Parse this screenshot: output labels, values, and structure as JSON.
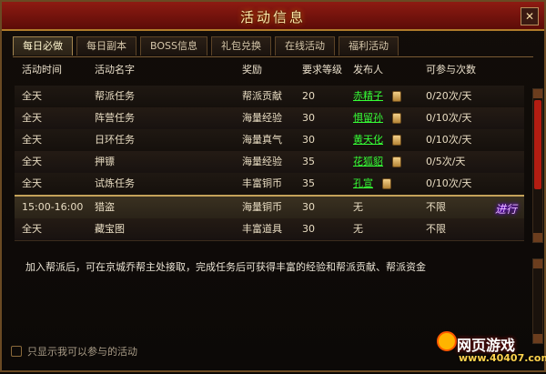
{
  "window": {
    "title": "活动信息",
    "close_glyph": "✕"
  },
  "tabs": [
    {
      "label": "每日必做",
      "active": true
    },
    {
      "label": "每日副本",
      "active": false
    },
    {
      "label": "BOSS信息",
      "active": false
    },
    {
      "label": "礼包兑换",
      "active": false
    },
    {
      "label": "在线活动",
      "active": false
    },
    {
      "label": "福利活动",
      "active": false
    }
  ],
  "table": {
    "headers": {
      "time": "活动时间",
      "name": "活动名字",
      "reward": "奖励",
      "level": "要求等级",
      "issuer": "发布人",
      "times": "可参与次数"
    },
    "rows": [
      {
        "time": "全天",
        "name": "帮派任务",
        "reward": "帮派贡献",
        "level": "20",
        "issuer": "赤精子",
        "times": "0/20次/天"
      },
      {
        "time": "全天",
        "name": "阵营任务",
        "reward": "海量经验",
        "level": "30",
        "issuer": "惧留孙",
        "times": "0/10次/天"
      },
      {
        "time": "全天",
        "name": "日环任务",
        "reward": "海量真气",
        "level": "30",
        "issuer": "黄天化",
        "times": "0/10次/天"
      },
      {
        "time": "全天",
        "name": "押镖",
        "reward": "海量经验",
        "level": "35",
        "issuer": "花狐貂",
        "times": "0/5次/天"
      },
      {
        "time": "全天",
        "name": "试炼任务",
        "reward": "丰富铜币",
        "level": "35",
        "issuer": "孔宣",
        "times": "0/10次/天"
      },
      {
        "time": "15:00-16:00",
        "name": "猎盗",
        "reward": "海量铜币",
        "level": "30",
        "issuer": "无",
        "times": "不限",
        "status": "进行中"
      },
      {
        "time": "全天",
        "name": "藏宝图",
        "reward": "丰富道具",
        "level": "30",
        "issuer": "无",
        "times": "不限"
      }
    ]
  },
  "description": "加入帮派后，可在京城乔帮主处接取，完成任务后可获得丰富的经验和帮派贡献、帮派资金",
  "filter_checkbox": {
    "label": "只显示我可以参与的活动",
    "checked": false
  },
  "watermark": {
    "top": "网页游戏",
    "bottom": "www.40407.com"
  },
  "colors": {
    "accent": "#b21d12",
    "issuer_link": "#36ff36",
    "gold": "#c4a25a"
  }
}
